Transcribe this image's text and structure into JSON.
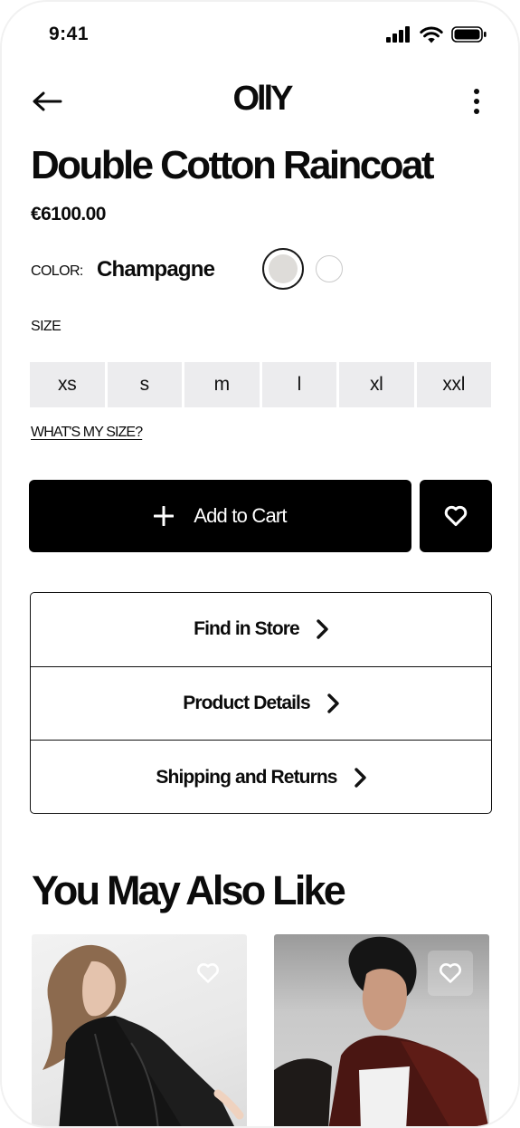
{
  "status_bar": {
    "time": "9:41"
  },
  "nav": {
    "logo": "OllY"
  },
  "product": {
    "title": "Double Cotton Raincoat",
    "price": "€6100.00",
    "color_label": "COLOR:",
    "color_value": "Champagne",
    "swatches": [
      {
        "name": "Champagne",
        "color": "#dedcd9",
        "selected": true
      },
      {
        "name": "White",
        "color": "#ffffff",
        "selected": false
      }
    ],
    "size_label": "SIZE",
    "sizes": [
      "xs",
      "s",
      "m",
      "l",
      "xl",
      "xxl"
    ],
    "size_guide_link": "WHAT'S MY SIZE?"
  },
  "actions": {
    "add_to_cart": "Add to Cart"
  },
  "accordion": [
    {
      "label": "Find in Store"
    },
    {
      "label": "Product Details"
    },
    {
      "label": "Shipping and Returns"
    }
  ],
  "recommendations": {
    "title": "You May Also Like"
  },
  "colors": {
    "primary": "#000000",
    "size_bg": "#ececee",
    "text": "#0b0b0b"
  },
  "icons": {
    "back": "arrow-left-icon",
    "more": "more-vertical-icon",
    "plus": "plus-icon",
    "heart": "heart-icon",
    "chevron": "chevron-right-icon"
  }
}
